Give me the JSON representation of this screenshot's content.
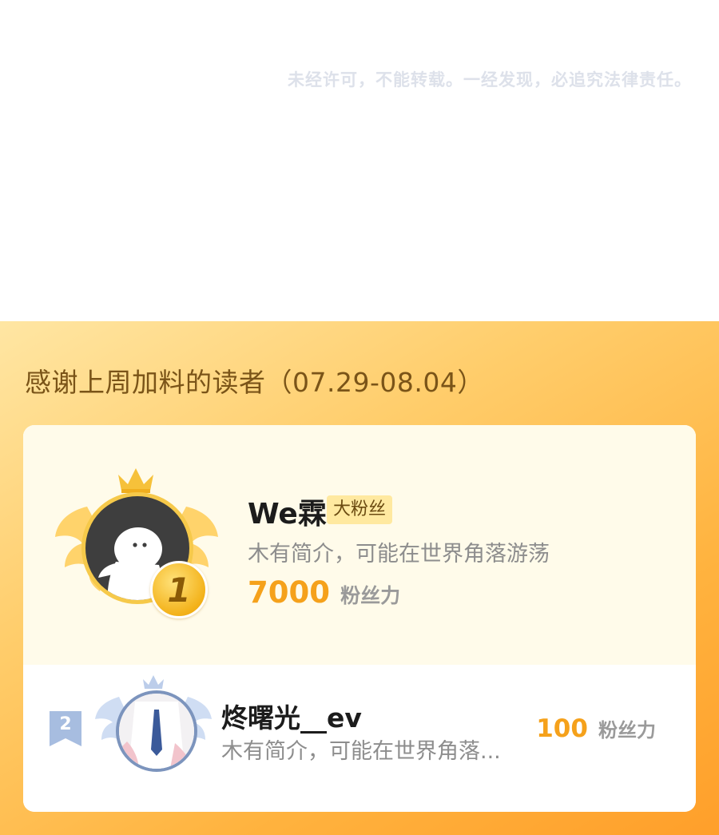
{
  "notice": "未经许可，不能转载。一经发现，必追究法律责任。",
  "panel": {
    "title": "感谢上周加料的读者（07.29-08.04）"
  },
  "leaderboard": [
    {
      "rank": "1",
      "name": "We霖",
      "badge": "大粉丝",
      "bio": "木有简介，可能在世界角落游荡",
      "power_value": "7000",
      "power_label": "粉丝力"
    },
    {
      "rank": "2",
      "name": "炵曙光__ev",
      "bio": "木有简介，可能在世界角落...",
      "power_value": "100",
      "power_label": "粉丝力"
    }
  ],
  "colors": {
    "accent": "#f5a11b",
    "panel_gradient_start": "#ffe6a3",
    "panel_gradient_end": "#ff9f2a",
    "medal_gold": "#f3b21a",
    "rank2_blue": "#7c94bd"
  }
}
